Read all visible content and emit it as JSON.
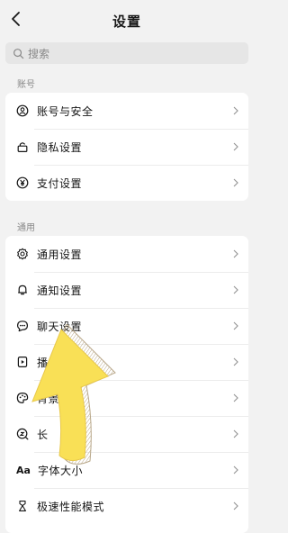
{
  "header": {
    "title": "设置"
  },
  "search": {
    "placeholder": "搜索"
  },
  "sections": {
    "account": {
      "label": "账号",
      "items": [
        {
          "label": "账号与安全",
          "icon": "account-security-icon"
        },
        {
          "label": "隐私设置",
          "icon": "lock-icon"
        },
        {
          "label": "支付设置",
          "icon": "yuan-icon"
        }
      ]
    },
    "general": {
      "label": "通用",
      "items": [
        {
          "label": "通用设置",
          "icon": "gear-icon"
        },
        {
          "label": "通知设置",
          "icon": "bell-icon"
        },
        {
          "label": "聊天设置",
          "icon": "chat-bubble-icon"
        },
        {
          "label": "播",
          "icon": "play-icon"
        },
        {
          "label": "背景",
          "icon": "palette-icon"
        },
        {
          "label": "长",
          "icon": "magnifier-icon"
        },
        {
          "label": "字体大小",
          "icon": "font-size-icon",
          "icon_text": "Aa"
        },
        {
          "label": "极速性能模式",
          "icon": "speed-mode-icon"
        }
      ]
    }
  },
  "colors": {
    "background": "#f2f2f2",
    "card": "#ffffff",
    "annotation_arrow": "#f9e056"
  }
}
